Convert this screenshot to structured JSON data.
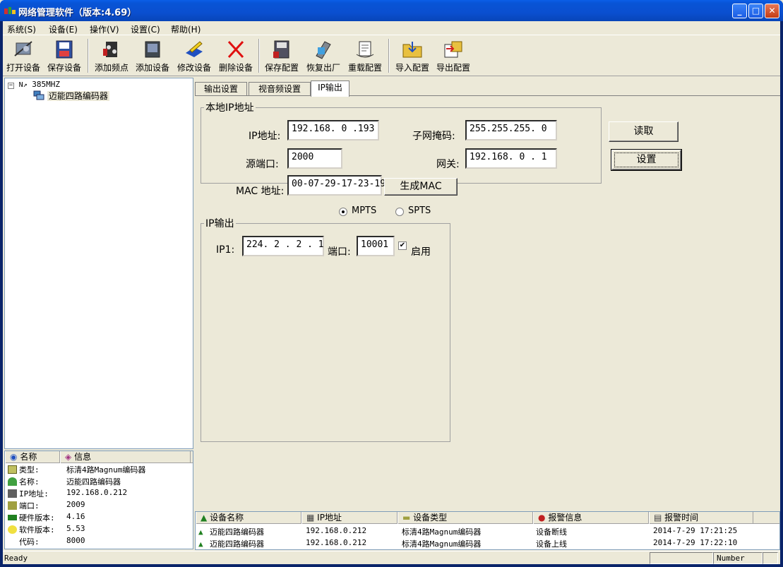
{
  "window": {
    "title": "网络管理软件（版本:4.69）"
  },
  "menu": [
    "系统(S)",
    "设备(E)",
    "操作(V)",
    "设置(C)",
    "帮助(H)"
  ],
  "toolbar": [
    {
      "label": "打开设备",
      "icon": "open-device-icon"
    },
    {
      "label": "保存设备",
      "icon": "save-device-icon"
    },
    {
      "label": "添加频点",
      "icon": "add-frequency-icon"
    },
    {
      "label": "添加设备",
      "icon": "add-device-icon"
    },
    {
      "label": "修改设备",
      "icon": "edit-device-icon"
    },
    {
      "label": "删除设备",
      "icon": "delete-icon"
    },
    {
      "label": "保存配置",
      "icon": "save-config-icon"
    },
    {
      "label": "恢复出厂",
      "icon": "restore-factory-icon"
    },
    {
      "label": "重载配置",
      "icon": "reload-config-icon"
    },
    {
      "label": "导入配置",
      "icon": "import-config-icon"
    },
    {
      "label": "导出配置",
      "icon": "export-config-icon"
    }
  ],
  "tree": {
    "root": "385MHZ",
    "child": "迈能四路编码器"
  },
  "info": {
    "headers": [
      "名称",
      "信息"
    ],
    "rows": [
      {
        "key": "类型:",
        "value": "标清4路Magnum编码器"
      },
      {
        "key": "名称:",
        "value": "迈能四路编码器"
      },
      {
        "key": "IP地址:",
        "value": "192.168.0.212"
      },
      {
        "key": "端口:",
        "value": "2009"
      },
      {
        "key": "硬件版本:",
        "value": "4.16"
      },
      {
        "key": "软件版本:",
        "value": "5.53"
      },
      {
        "key": "代码:",
        "value": "8000"
      }
    ]
  },
  "tabs": [
    "输出设置",
    "视音频设置",
    "IP输出"
  ],
  "local_ip": {
    "legend": "本地IP地址",
    "ip_label": "IP地址:",
    "ip_value": "192.168. 0 .193",
    "mask_label": "子网掩码:",
    "mask_value": "255.255.255. 0",
    "port_label": "源端口:",
    "port_value": "2000",
    "gateway_label": "网关:",
    "gateway_value": "192.168. 0 . 1",
    "mac_label": "MAC 地址:",
    "mac_value": "00-07-29-17-23-19",
    "gen_mac_button": "生成MAC"
  },
  "buttons": {
    "read": "读取",
    "set": "设置"
  },
  "mode": {
    "mpts": "MPTS",
    "spts": "SPTS",
    "selected": "MPTS"
  },
  "ip_output": {
    "legend": "IP输出",
    "ip_label": "IP1:",
    "ip_value": "224. 2 . 2 . 1",
    "port_label": "端口:",
    "port_value": "10001",
    "enable_label": "启用",
    "enabled": true
  },
  "alarms": {
    "headers": [
      "设备名称",
      "IP地址",
      "设备类型",
      "报警信息",
      "报警时间"
    ],
    "rows": [
      [
        "迈能四路编码器",
        "192.168.0.212",
        "标清4路Magnum编码器",
        "设备断线",
        "2014-7-29  17:21:25"
      ],
      [
        "迈能四路编码器",
        "192.168.0.212",
        "标清4路Magnum编码器",
        "设备上线",
        "2014-7-29  17:22:10"
      ]
    ]
  },
  "status": {
    "text": "Ready",
    "number": "Number"
  }
}
